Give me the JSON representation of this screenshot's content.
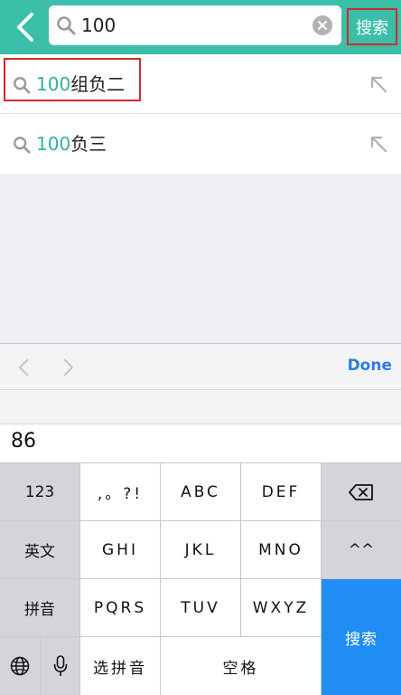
{
  "search": {
    "query": "100",
    "submit_label": "搜索"
  },
  "suggestions": [
    {
      "highlight": "100",
      "rest": "组负二"
    },
    {
      "highlight": "100",
      "rest": "负三"
    }
  ],
  "keyboard_toolbar": {
    "done_label": "Done"
  },
  "candidate": "86",
  "keys": {
    "row1": [
      "123",
      ",。?!",
      "ABC",
      "DEF"
    ],
    "row2": [
      "英文",
      "GHI",
      "JKL",
      "MNO",
      "^^"
    ],
    "row3": [
      "拼音",
      "PQRS",
      "TUV",
      "WXYZ"
    ],
    "row4": [
      "选拼音",
      "空格"
    ],
    "go": "搜索"
  },
  "colors": {
    "header": "#3cbfa8",
    "highlight": "#2fb29b",
    "outline": "#d12a2a",
    "go_key": "#1f8df3"
  }
}
